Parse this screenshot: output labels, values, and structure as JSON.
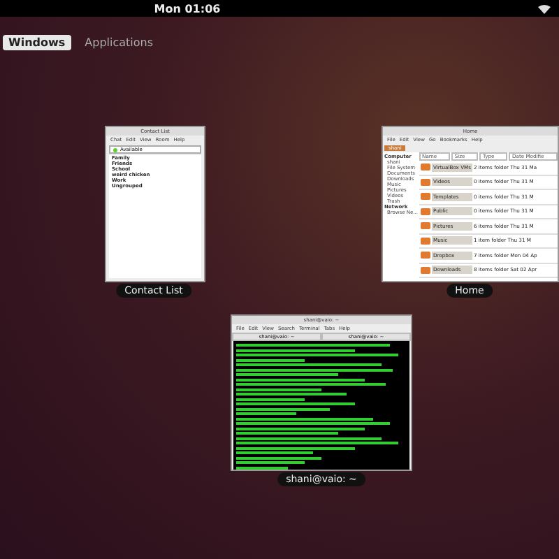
{
  "top_bar": {
    "clock": "Mon 01:06"
  },
  "tabs": [
    {
      "label": "Windows",
      "selected": true
    },
    {
      "label": "Applications",
      "selected": false
    }
  ],
  "windows": [
    {
      "kind": "contacts",
      "caption": "Contact List",
      "title": "Contact List",
      "menu": [
        "Chat",
        "Edit",
        "View",
        "Room",
        "Help"
      ],
      "status": "Available",
      "groups": [
        "Family",
        "Friends",
        "School",
        "weird chicken",
        "Work",
        "Ungrouped"
      ]
    },
    {
      "kind": "files",
      "caption": "Home",
      "title": "Home",
      "menu": [
        "File",
        "Edit",
        "View",
        "Go",
        "Bookmarks",
        "Help"
      ],
      "location": "shani",
      "places_header": "Computer",
      "places": [
        "shani",
        "File System",
        "Documents",
        "Downloads",
        "Music",
        "Pictures",
        "Videos",
        "Trash"
      ],
      "network_header": "Network",
      "network": [
        "Browse Ne..."
      ],
      "columns": [
        "Name",
        "Size",
        "Type",
        "Date Modifie"
      ],
      "rows": [
        {
          "name": "VirtualBox VMs",
          "info": "2 items folder Thu 31 Ma"
        },
        {
          "name": "Videos",
          "info": "0 items folder Thu 31 M"
        },
        {
          "name": "Templates",
          "info": "0 items folder Thu 31 M"
        },
        {
          "name": "Public",
          "info": "0 items folder Thu 31 M"
        },
        {
          "name": "Pictures",
          "info": "6 items folder Thu 31 M"
        },
        {
          "name": "Music",
          "info": "1 item folder Thu 31 M"
        },
        {
          "name": "Dropbox",
          "info": "7 items folder Mon 04 Ap"
        },
        {
          "name": "Downloads",
          "info": "8 items folder Sat 02 Apr"
        }
      ]
    },
    {
      "kind": "terminal",
      "caption": "shani@vaio: ~",
      "title": "shani@vaio: ~",
      "menu": [
        "File",
        "Edit",
        "View",
        "Search",
        "Terminal",
        "Tabs",
        "Help"
      ],
      "tabs": [
        "shani@vaio: ~",
        "shani@vaio: ~"
      ]
    }
  ]
}
